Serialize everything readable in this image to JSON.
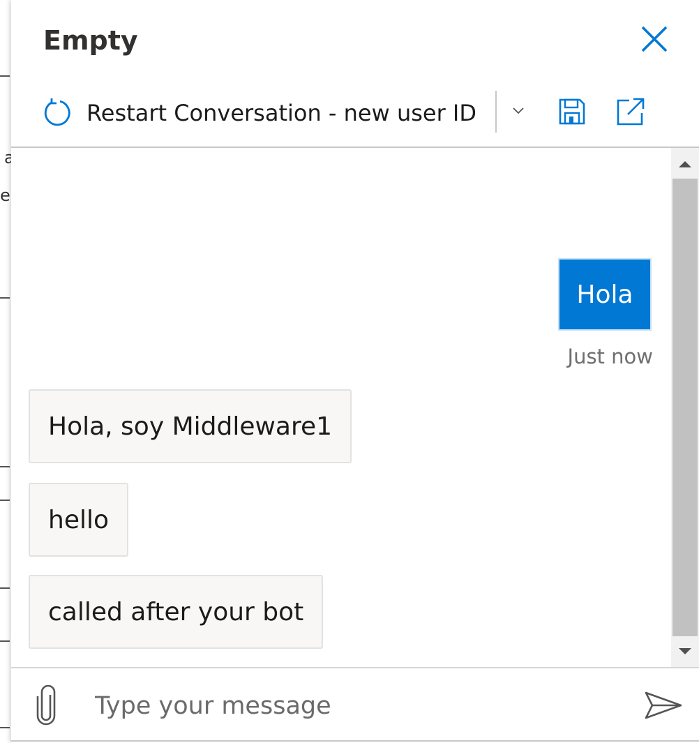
{
  "background": {
    "fragments": [
      "a",
      "ec"
    ]
  },
  "panel": {
    "title": "Empty",
    "close_icon": "close-icon"
  },
  "toolbar": {
    "restart_label": "Restart Conversation - new user ID",
    "restart_icon": "refresh-icon",
    "dropdown_icon": "chevron-down-icon",
    "save_icon": "save-icon",
    "popout_icon": "open-external-icon"
  },
  "transcript": {
    "user_message": {
      "text": "Hola",
      "timestamp": "Just now"
    },
    "bot_messages": [
      {
        "text": "Hola, soy Middleware1"
      },
      {
        "text": "hello"
      },
      {
        "text": "called after your bot"
      }
    ]
  },
  "composer": {
    "placeholder": "Type your message",
    "value": "",
    "attach_icon": "paperclip-icon",
    "send_icon": "send-icon"
  },
  "colors": {
    "accent": "#0078d4",
    "bot_bubble": "#f8f7f6",
    "timestamp": "#6f6f6f"
  }
}
